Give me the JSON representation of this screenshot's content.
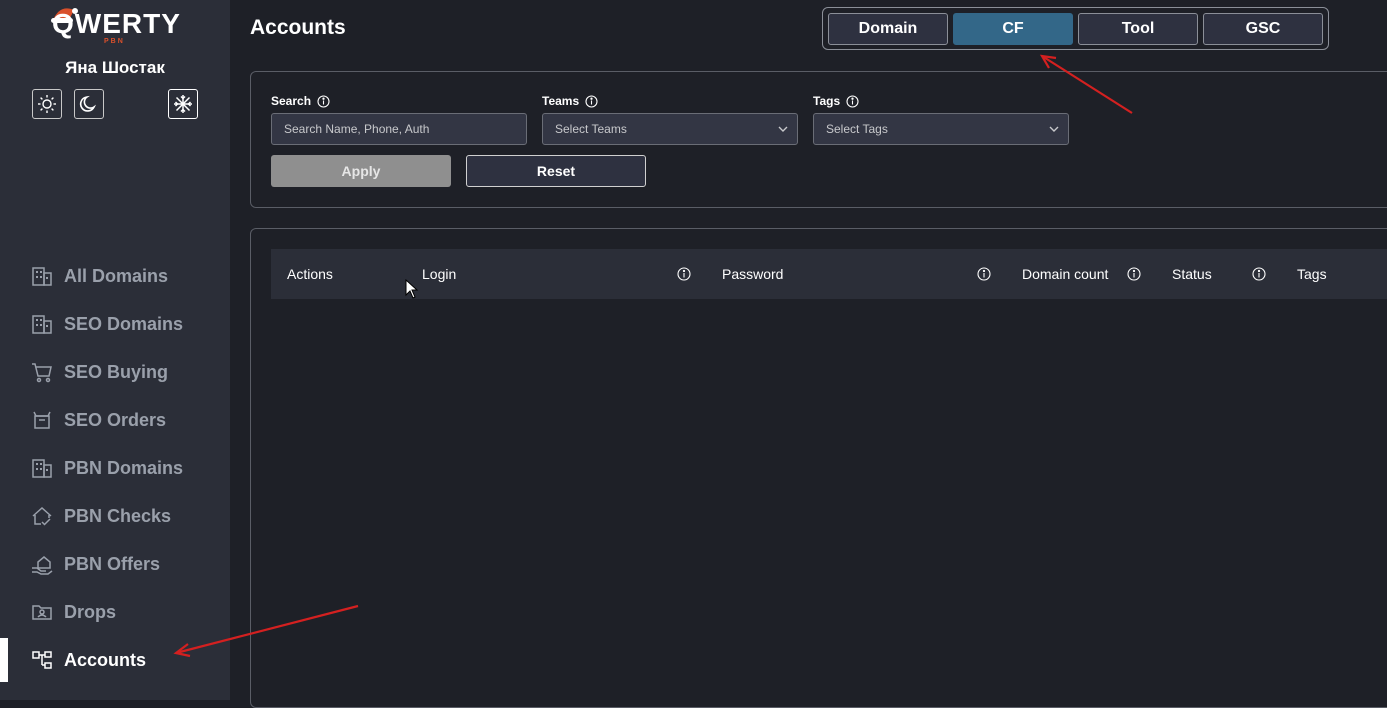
{
  "brand": {
    "logo_text": "QWERTY",
    "logo_sub": "PBN"
  },
  "user": {
    "name": "Яна Шостак"
  },
  "theme_buttons": [
    {
      "name": "light-theme-button",
      "icon": "sun-icon"
    },
    {
      "name": "dark-theme-button",
      "icon": "moon-icon"
    },
    {
      "name": "winter-theme-button",
      "icon": "snowflake-icon"
    }
  ],
  "sidebar": {
    "items": [
      {
        "label": "All Domains",
        "icon": "building-icon"
      },
      {
        "label": "SEO Domains",
        "icon": "building-icon"
      },
      {
        "label": "SEO Buying",
        "icon": "cart-icon"
      },
      {
        "label": "SEO Orders",
        "icon": "box-icon"
      },
      {
        "label": "PBN Domains",
        "icon": "building-icon"
      },
      {
        "label": "PBN Checks",
        "icon": "house-check-icon"
      },
      {
        "label": "PBN Offers",
        "icon": "hand-house-icon"
      },
      {
        "label": "Drops",
        "icon": "folder-user-icon"
      },
      {
        "label": "Accounts",
        "icon": "hierarchy-icon",
        "active": true
      }
    ]
  },
  "page": {
    "title": "Accounts"
  },
  "tabs": [
    {
      "label": "Domain"
    },
    {
      "label": "CF",
      "active": true
    },
    {
      "label": "Tool"
    },
    {
      "label": "GSC"
    }
  ],
  "filters": {
    "search": {
      "label": "Search",
      "placeholder": "Search Name, Phone, Auth"
    },
    "teams": {
      "label": "Teams",
      "placeholder": "Select Teams"
    },
    "tags": {
      "label": "Tags",
      "placeholder": "Select Tags"
    },
    "apply_label": "Apply",
    "reset_label": "Reset"
  },
  "table": {
    "columns": [
      {
        "label": "Actions"
      },
      {
        "label": "Login"
      },
      {
        "label": "Password"
      },
      {
        "label": "Domain count"
      },
      {
        "label": "Status"
      },
      {
        "label": "Tags"
      }
    ]
  },
  "colors": {
    "accent_tab": "#336788",
    "annotation_arrow": "#d42020",
    "background": "#1e2027",
    "sidebar": "#2b2e38"
  }
}
